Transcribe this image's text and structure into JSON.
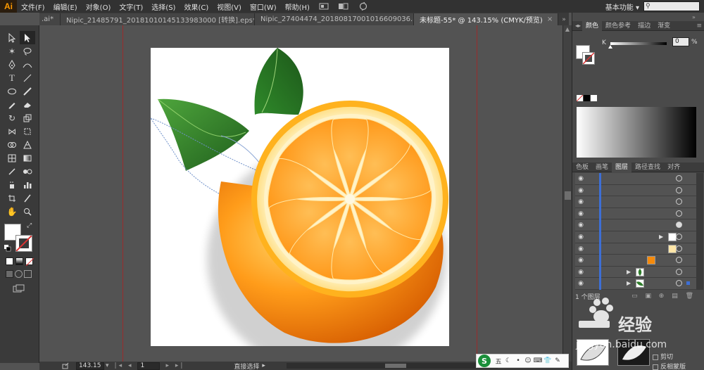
{
  "app": {
    "logo": "Ai",
    "menus": [
      "文件(F)",
      "编辑(E)",
      "对象(O)",
      "文字(T)",
      "选择(S)",
      "效果(C)",
      "视图(V)",
      "窗口(W)",
      "帮助(H)"
    ],
    "workspace": "基本功能",
    "search_placeholder": ""
  },
  "tabs": [
    {
      "label": ".ai*",
      "active": false
    },
    {
      "label": "Nipic_21485791_20181010145133983000 [转换].eps*",
      "active": false
    },
    {
      "label": "Nipic_27404474_20180817001016609036.ai*",
      "active": false
    },
    {
      "label": "未标题-55* @ 143.15% (CMYK/预览)",
      "active": true
    }
  ],
  "status": {
    "zoom": "143.15",
    "page": "1",
    "tool_name": "直接选择"
  },
  "panels": {
    "color_tabs": [
      "颜色",
      "颜色参考",
      "描边",
      "渐变"
    ],
    "color_channel": "K",
    "color_value": "0",
    "color_unit": "%",
    "layer_tabs": [
      "色板",
      "画笔",
      "图层",
      "路径查找",
      "对齐"
    ],
    "layer_count": "1 个图层",
    "mask_options": [
      "剪切",
      "反相蒙版"
    ]
  },
  "ime": {
    "logo": "S",
    "label": "五"
  },
  "watermark": {
    "text_cn": "经验",
    "text_en": "jingyan.baidu.com"
  },
  "colors": {
    "accent_orange": "#f58a0b",
    "leaf_green": "#2f7d2b",
    "selection_blue": "#3d6fd6",
    "guide_red": "#9a2b2b"
  }
}
